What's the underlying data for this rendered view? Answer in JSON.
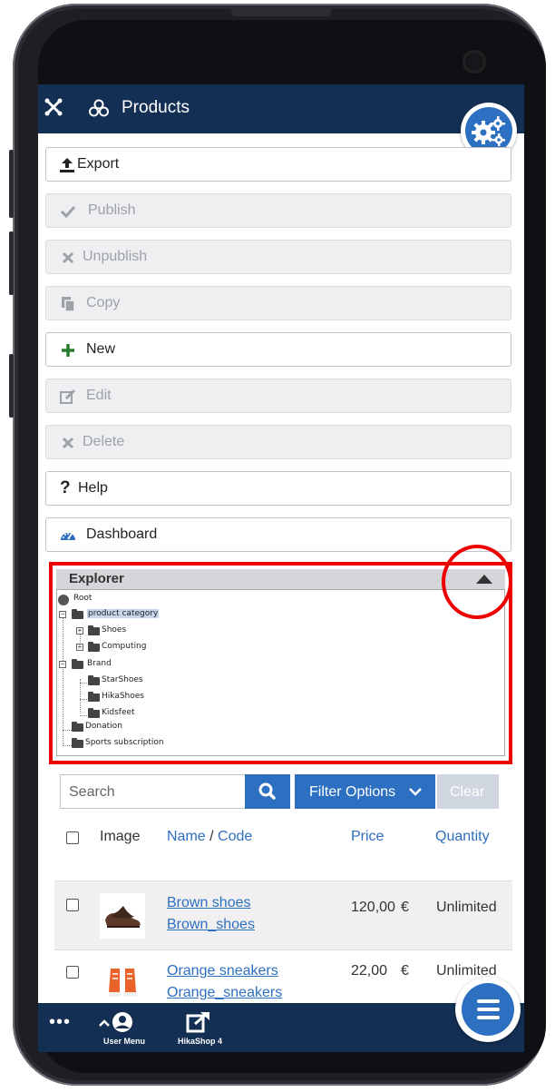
{
  "header": {
    "title": "Products"
  },
  "toolbar": {
    "export": "Export",
    "publish": "Publish",
    "unpublish": "Unpublish",
    "copy": "Copy",
    "new": "New",
    "edit": "Edit",
    "delete": "Delete",
    "help": "Help",
    "dashboard": "Dashboard"
  },
  "explorer": {
    "title": "Explorer",
    "root": "Root",
    "product_category": "product category",
    "shoes": "Shoes",
    "computing": "Computing",
    "brand": "Brand",
    "starshoes": "StarShoes",
    "hikashoes": "HikaShoes",
    "kidsfeet": "Kidsfeet",
    "donation": "Donation",
    "sports": "Sports subscription"
  },
  "search": {
    "placeholder": "Search"
  },
  "filter": {
    "label": "Filter Options",
    "clear": "Clear"
  },
  "table": {
    "headers": {
      "image": "Image",
      "name": "Name",
      "sep": " / ",
      "code": "Code",
      "price": "Price",
      "quantity": "Quantity"
    },
    "rows": [
      {
        "name": "Brown shoes",
        "code": "Brown_shoes",
        "price": "120,00",
        "currency": "€",
        "quantity": "Unlimited"
      },
      {
        "name": "Orange sneakers",
        "code": "Orange_sneakers",
        "price": "22,00",
        "currency": "€",
        "quantity": "Unlimited"
      }
    ]
  },
  "bottombar": {
    "user_menu": "User Menu",
    "hikashop": "HikaShop 4",
    "more": "•••"
  },
  "colors": {
    "brand_navy": "#132f53",
    "accent_blue": "#2d6fc0",
    "annotation_red": "#e00000"
  }
}
